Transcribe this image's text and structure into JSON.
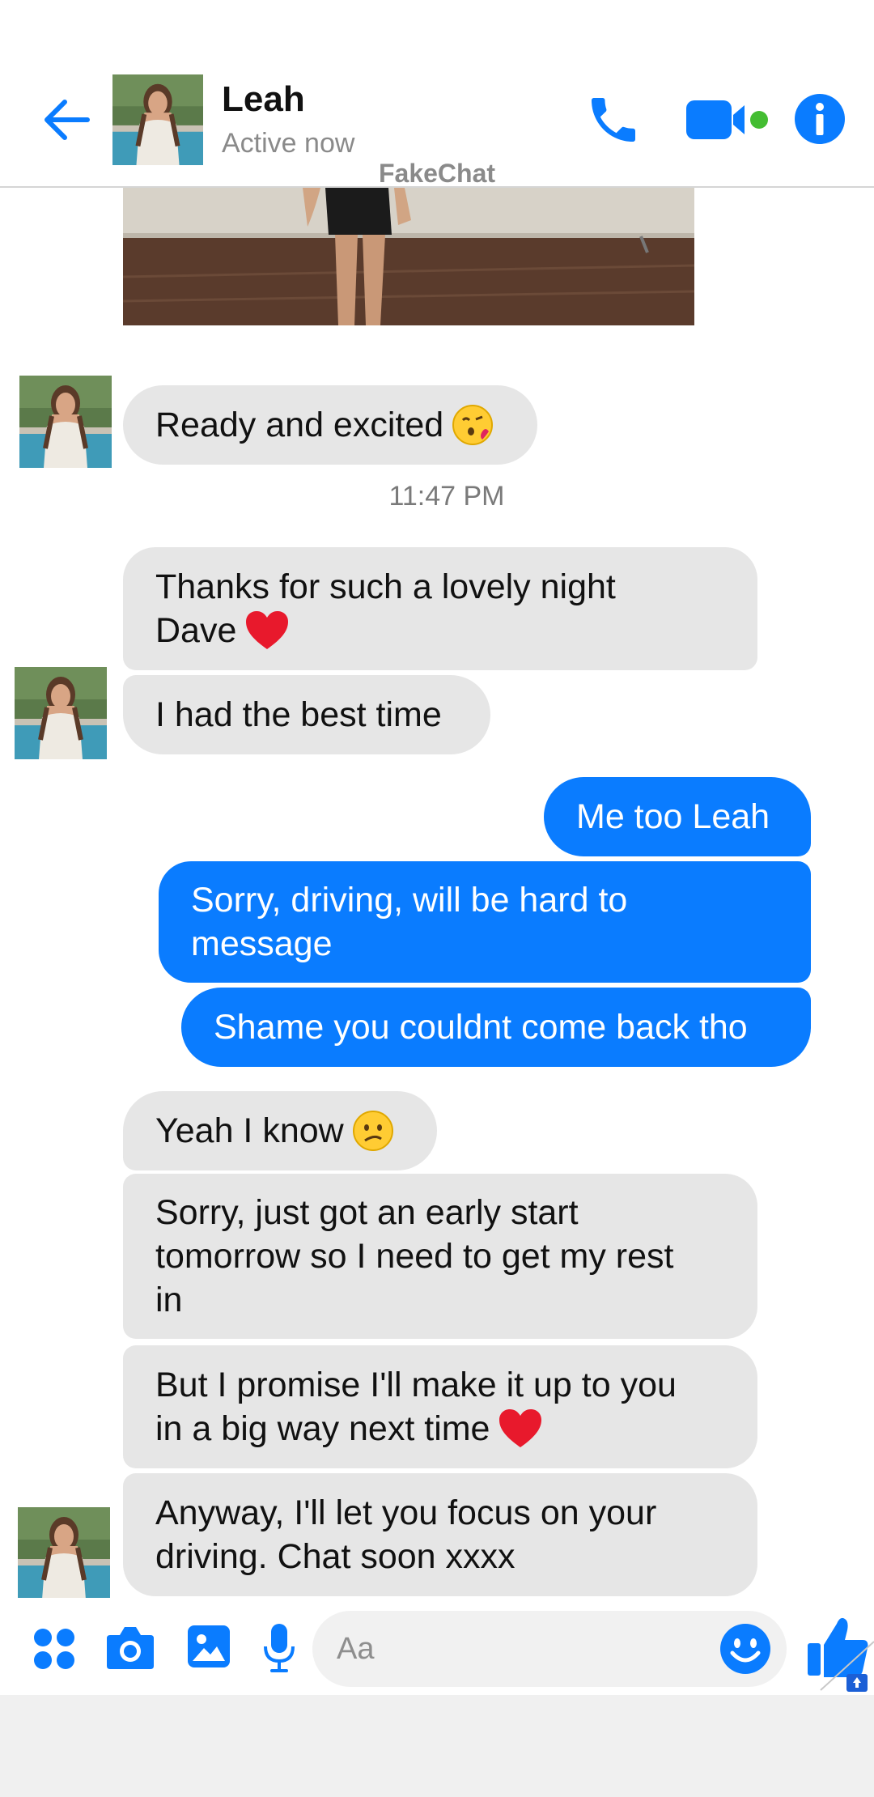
{
  "header": {
    "contact_name": "Leah",
    "status": "Active now",
    "watermark": "FakeChat"
  },
  "thread": {
    "timestamp": "11:47 PM",
    "messages": [
      {
        "from": "them",
        "text": "Ready and excited",
        "emoji": "kiss-emoji"
      },
      {
        "from": "them",
        "line1": "Thanks for such a lovely night",
        "line2": "Dave",
        "emoji": "red-heart-emoji"
      },
      {
        "from": "them",
        "text": "I had the best time"
      },
      {
        "from": "me",
        "text": "Me too Leah"
      },
      {
        "from": "me",
        "line1": "Sorry, driving, will be hard to",
        "line2": "message"
      },
      {
        "from": "me",
        "text": "Shame you couldnt come back tho"
      },
      {
        "from": "them",
        "text": "Yeah I know",
        "emoji": "confused-face-emoji"
      },
      {
        "from": "them",
        "line1": "Sorry, just got an early start",
        "line2": "tomorrow so I need to get my rest",
        "line3": "in"
      },
      {
        "from": "them",
        "line1": "But I promise I'll make it up to you",
        "line2": "in a big way next time",
        "emoji": "red-heart-emoji"
      },
      {
        "from": "them",
        "line1": "Anyway, I'll let you focus on your",
        "line2": "driving. Chat soon xxxx"
      }
    ]
  },
  "composer": {
    "placeholder": "Aa"
  },
  "colors": {
    "accent": "#0a7cff",
    "incoming_bubble": "#e6e6e6",
    "active_dot": "#44bd32"
  },
  "icons": [
    "back-arrow-icon",
    "phone-icon",
    "video-camera-icon",
    "info-icon",
    "apps-grid-icon",
    "camera-icon",
    "photo-gallery-icon",
    "microphone-icon",
    "smiley-icon",
    "thumbs-up-icon"
  ]
}
